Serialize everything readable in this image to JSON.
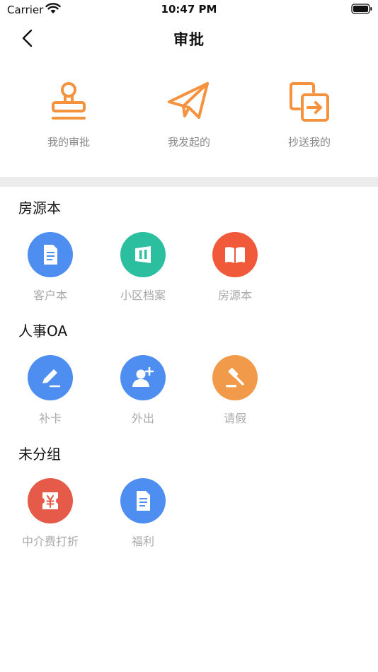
{
  "status": {
    "carrier": "Carrier",
    "time": "10:47 PM"
  },
  "nav": {
    "title": "审批"
  },
  "top_actions": [
    {
      "label": "我的审批",
      "icon": "stamp-icon"
    },
    {
      "label": "我发起的",
      "icon": "paper-plane-icon"
    },
    {
      "label": "抄送我的",
      "icon": "share-copy-icon"
    }
  ],
  "sections": [
    {
      "title": "房源本",
      "items": [
        {
          "label": "客户本",
          "icon": "document-icon",
          "color": "#4d8ef0"
        },
        {
          "label": "小区档案",
          "icon": "archive-icon",
          "color": "#2bbf9f"
        },
        {
          "label": "房源本",
          "icon": "book-icon",
          "color": "#f05a3a"
        }
      ]
    },
    {
      "title": "人事OA",
      "items": [
        {
          "label": "补卡",
          "icon": "pen-sign-icon",
          "color": "#4d8ef0"
        },
        {
          "label": "外出",
          "icon": "user-add-icon",
          "color": "#4d8ef0"
        },
        {
          "label": "请假",
          "icon": "gavel-icon",
          "color": "#f09a4a"
        }
      ]
    },
    {
      "title": "未分组",
      "items": [
        {
          "label": "中介费打折",
          "icon": "yuan-coupon-icon",
          "color": "#e55a48"
        },
        {
          "label": "福利",
          "icon": "document-icon",
          "color": "#4d8ef0"
        }
      ]
    }
  ],
  "colors": {
    "accent_orange": "#f5923e",
    "divider": "#ececec",
    "label_gray": "#aaaaaa"
  }
}
